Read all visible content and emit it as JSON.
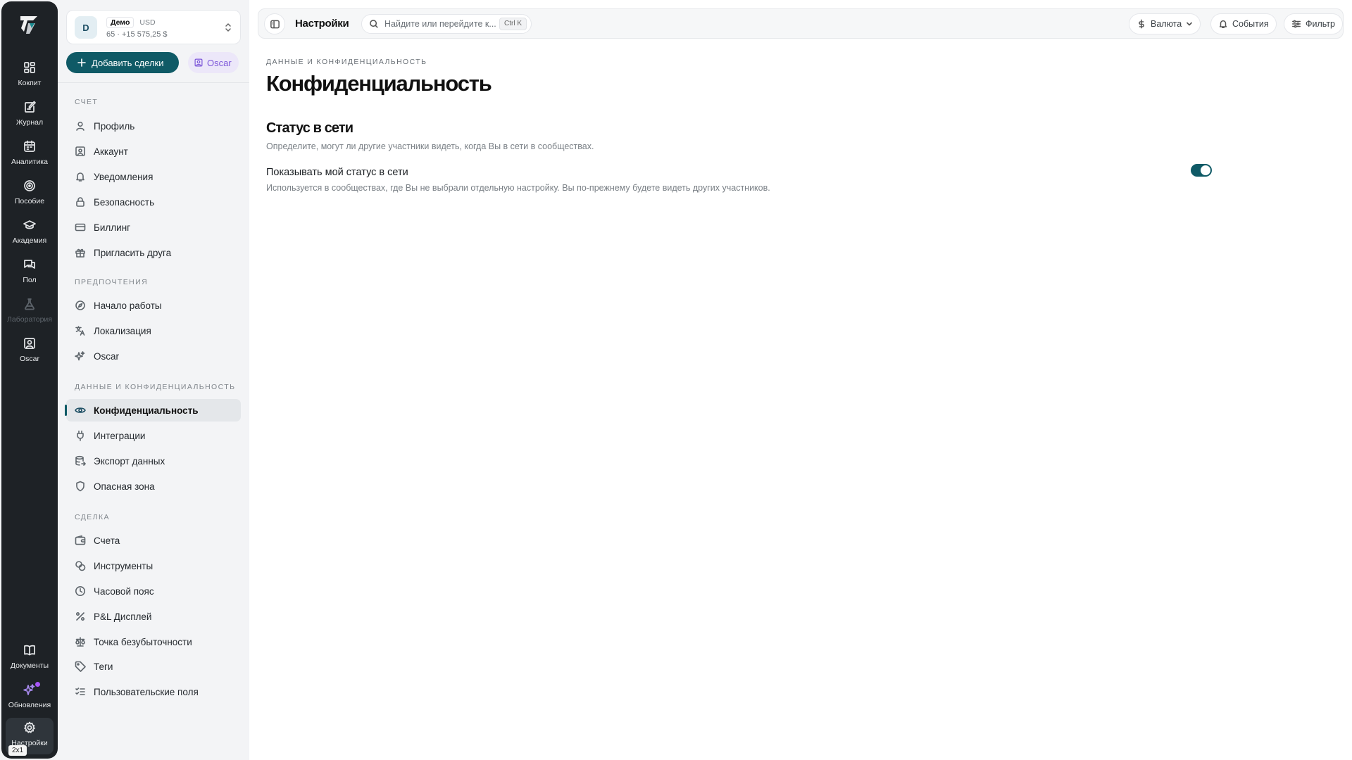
{
  "rail": {
    "items": [
      {
        "label": "Кокпит",
        "icon": "grid-icon"
      },
      {
        "label": "Журнал",
        "icon": "journal-icon"
      },
      {
        "label": "Аналитика",
        "icon": "calendar-icon"
      },
      {
        "label": "Пособие",
        "icon": "target-icon"
      },
      {
        "label": "Академия",
        "icon": "graduation-cap-icon"
      },
      {
        "label": "Пол",
        "icon": "chat-icon"
      },
      {
        "label": "Лаборатория",
        "icon": "flask-icon"
      },
      {
        "label": "Oscar",
        "icon": "portrait-icon"
      }
    ],
    "bottom": [
      {
        "label": "Документы",
        "icon": "book-icon"
      },
      {
        "label": "Обновления",
        "icon": "sparkles-icon"
      },
      {
        "label": "Настройки",
        "icon": "gear-icon"
      }
    ],
    "badge": "2x1"
  },
  "account": {
    "avatar": "D",
    "tag": "Демо",
    "currency": "USD",
    "balance": "65 · +15 575,25 $"
  },
  "actions": {
    "add_label": "Добавить сделки",
    "oscar_label": "Oscar"
  },
  "sidebar": {
    "sections": [
      {
        "title": "СЧЕТ",
        "items": [
          "Профиль",
          "Аккаунт",
          "Уведомления",
          "Безопасность",
          "Биллинг",
          "Пригласить друга"
        ]
      },
      {
        "title": "ПРЕДПОЧТЕНИЯ",
        "items": [
          "Начало работы",
          "Локализация",
          "Oscar"
        ]
      },
      {
        "title": "ДАННЫЕ И КОНФИДЕНЦИАЛЬНОСТЬ",
        "items": [
          "Конфиденциальность",
          "Интеграции",
          "Экспорт данных",
          "Опасная зона"
        ]
      },
      {
        "title": "СДЕЛКА",
        "items": [
          "Счета",
          "Инструменты",
          "Часовой пояс",
          "P&L Дисплей",
          "Точка безубыточности",
          "Теги",
          "Пользовательские поля"
        ]
      }
    ],
    "active_item": "Конфиденциальность"
  },
  "topbar": {
    "title": "Настройки",
    "search_placeholder": "Найдите или перейдите к...",
    "search_shortcut": "Ctrl K",
    "currency_label": "Валюта",
    "events_label": "События",
    "filter_label": "Фильтр"
  },
  "content": {
    "breadcrumb": "ДАННЫЕ И КОНФИДЕНЦИАЛЬНОСТЬ",
    "title": "Конфиденциальность",
    "section_title": "Статус в сети",
    "section_desc": "Определите, могут ли другие участники видеть, когда Вы в сети в сообществах.",
    "setting_label": "Показывать мой статус в сети",
    "setting_desc": "Используется в сообществах, где Вы не выбрали отдельную настройку. Вы по-прежнему будете видеть других участников.",
    "setting_enabled": true
  },
  "colors": {
    "rail_bg": "#1e2226",
    "accent": "#0f5a66",
    "oscar_accent": "#7c56d9"
  }
}
